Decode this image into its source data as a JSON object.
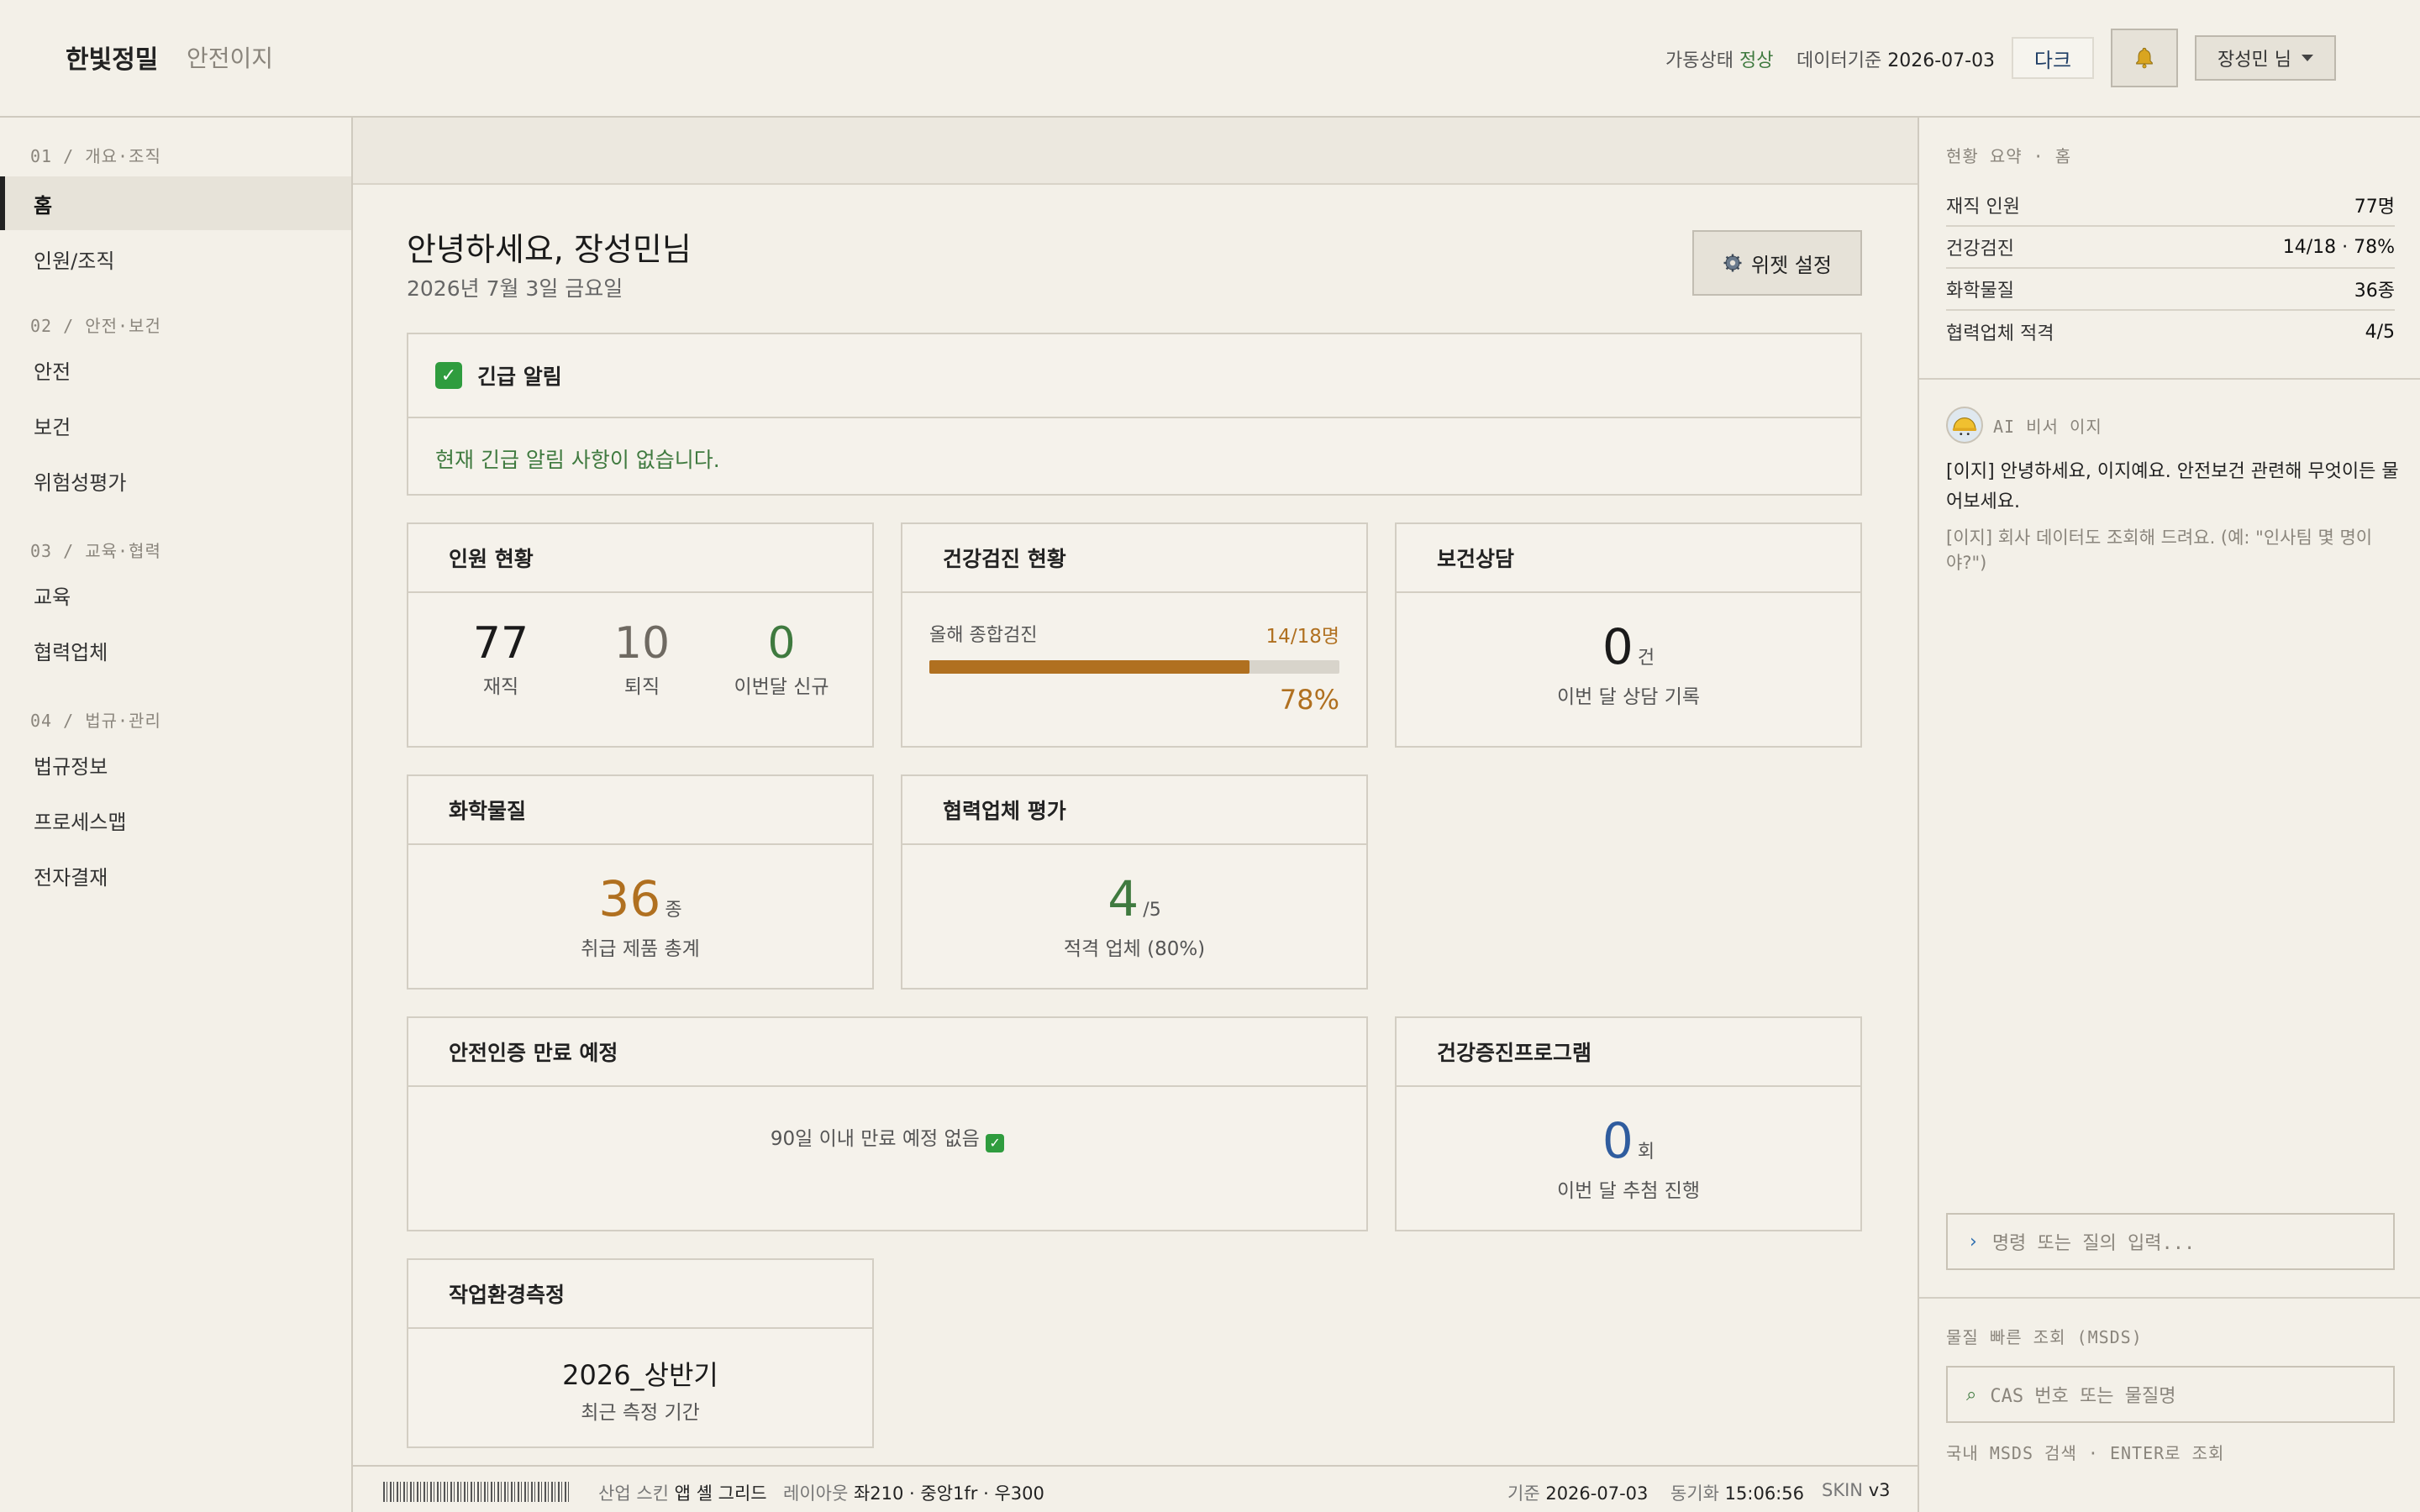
{
  "header": {
    "brand": "한빛정밀",
    "product": "안전이지",
    "status_label": "가동상태",
    "status_value": "정상",
    "data_date_label": "데이터기준",
    "data_date_value": "2026-07-03",
    "dark_button": "다크",
    "bell_icon": "bell-icon",
    "user_label": "장성민 님"
  },
  "sidebar": {
    "sections": [
      {
        "title": "01 / 개요·조직",
        "items": [
          "홈",
          "인원/조직"
        ]
      },
      {
        "title": "02 / 안전·보건",
        "items": [
          "안전",
          "보건",
          "위험성평가"
        ]
      },
      {
        "title": "03 / 교육·협력",
        "items": [
          "교육",
          "협력업체"
        ]
      },
      {
        "title": "04 / 법규·관리",
        "items": [
          "법규정보",
          "프로세스맵",
          "전자결재"
        ]
      }
    ],
    "active": "홈"
  },
  "main": {
    "greeting": "안녕하세요, 장성민님",
    "date": "2026년 7월 3일 금요일",
    "widget_button": "위젯 설정",
    "alert": {
      "title": "긴급 알림",
      "message": "현재 긴급 알림 사항이 없습니다."
    },
    "staff": {
      "title": "인원 현황",
      "stats": [
        {
          "value": "77",
          "label": "재직",
          "color": "#1a1a1a"
        },
        {
          "value": "10",
          "label": "퇴직",
          "color": "#6f6a62"
        },
        {
          "value": "0",
          "label": "이번달 신규",
          "color": "#3f7a3f"
        }
      ]
    },
    "checkup": {
      "title": "건강검진 현황",
      "label": "올해 종합검진",
      "count": "14/18명",
      "percent_text": "78%",
      "progress": 0.78,
      "color": "#b07020"
    },
    "counsel": {
      "title": "보건상담",
      "value": "0",
      "unit": "건",
      "sub": "이번 달 상담 기록"
    },
    "chemical": {
      "title": "화학물질",
      "value": "36",
      "unit": "종",
      "sub": "취급 제품 총계",
      "color": "#b07020"
    },
    "vendor": {
      "title": "협력업체 평가",
      "value": "4",
      "unit": "/5",
      "sub": "적격 업체 (80%)",
      "color": "#3f7a3f"
    },
    "cert": {
      "title": "안전인증 만료 예정",
      "message": "90일 이내 만료 예정 없음"
    },
    "program": {
      "title": "건강증진프로그램",
      "value": "0",
      "unit": "회",
      "sub": "이번 달 추첨 진행",
      "color": "#2f5c9e"
    },
    "env": {
      "title": "작업환경측정",
      "value": "2026_상반기",
      "sub": "최근 측정 기간"
    }
  },
  "right_panel": {
    "summary_title": "현황 요약 · 홈",
    "summary": [
      {
        "label": "재직 인원",
        "value": "77명"
      },
      {
        "label": "건강검진",
        "value": "14/18 · 78%"
      },
      {
        "label": "화학물질",
        "value": "36종"
      },
      {
        "label": "협력업체 적격",
        "value": "4/5"
      }
    ],
    "ai_title": "AI 비서 이지",
    "ai_message": "[이지] 안녕하세요, 이지예요. 안전보건 관련해 무엇이든 물어보세요.",
    "ai_hint": "[이지] 회사 데이터도 조회해 드려요. (예: \"인사팀 몇 명이야?\")",
    "command_placeholder": "명령 또는 질의 입력...",
    "msds_title": "물질 빠른 조회 (MSDS)",
    "msds_placeholder": "CAS 번호 또는 물질명",
    "msds_hint": "국내 MSDS 검색 · ENTER로 조회"
  },
  "footer": {
    "skin_label": "산업 스킨",
    "skin_value": "앱 셸 그리드",
    "layout_label": "레이아웃",
    "layout_value": "좌210 · 중앙1fr · 우300",
    "base_label": "기준",
    "base_value": "2026-07-03",
    "sync_label": "동기화",
    "sync_value": "15:06:56",
    "version_label": "SKIN",
    "version_value": "v3"
  }
}
